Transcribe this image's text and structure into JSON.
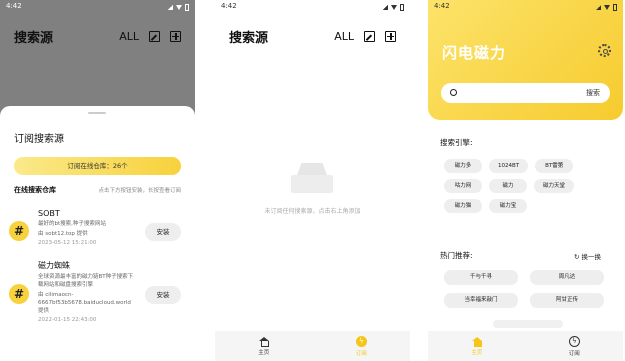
{
  "status": {
    "time": "4:42"
  },
  "screen1": {
    "title": "搜索源",
    "all_label": "ALL",
    "sheet_title": "订阅搜索源",
    "subscribe_pill": "订阅在线仓库：26个",
    "online_repo": "在线搜索仓库",
    "online_hint": "点击下方按钮安装，长按查看订阅",
    "sources": [
      {
        "name": "SOBT",
        "desc": "最好的bt搜索,种子搜索网站",
        "provider": "由 sobt12.top 提供",
        "date": "2023-05-12 15:21:00",
        "install": "安装"
      },
      {
        "name": "磁力蜘蛛",
        "desc": "全球资源最丰富的磁力链BT种子搜索下载网站和磁盘搜索引擎",
        "provider": "由 cilimaocn-6667bf53b5678.baiducloud.world 提供",
        "date": "2022-01-15 22:43:00",
        "install": "安装"
      }
    ]
  },
  "screen2": {
    "title": "搜索源",
    "all_label": "ALL",
    "empty_text": "未订阅任何搜索源，点击右上角添加",
    "nav": {
      "home": "主页",
      "subscribe": "订阅"
    }
  },
  "screen3": {
    "brand": "闪电磁力",
    "search_button": "搜索",
    "engines_title": "搜索引擎:",
    "engines": [
      "磁力多",
      "1024BT",
      "BT雷第",
      "咕力网",
      "磁力",
      "磁力天堂",
      "磁力猫",
      "磁力宝"
    ],
    "hot_title": "热门推荐:",
    "refresh_label": "换一换",
    "hot": [
      "千与千寻",
      "周凡达",
      "当幸福来敲门",
      "阿甘正传"
    ],
    "nav": {
      "home": "主页",
      "subscribe": "订阅"
    }
  },
  "colors": {
    "accent": "#f5c518",
    "overlay": "#808080"
  }
}
